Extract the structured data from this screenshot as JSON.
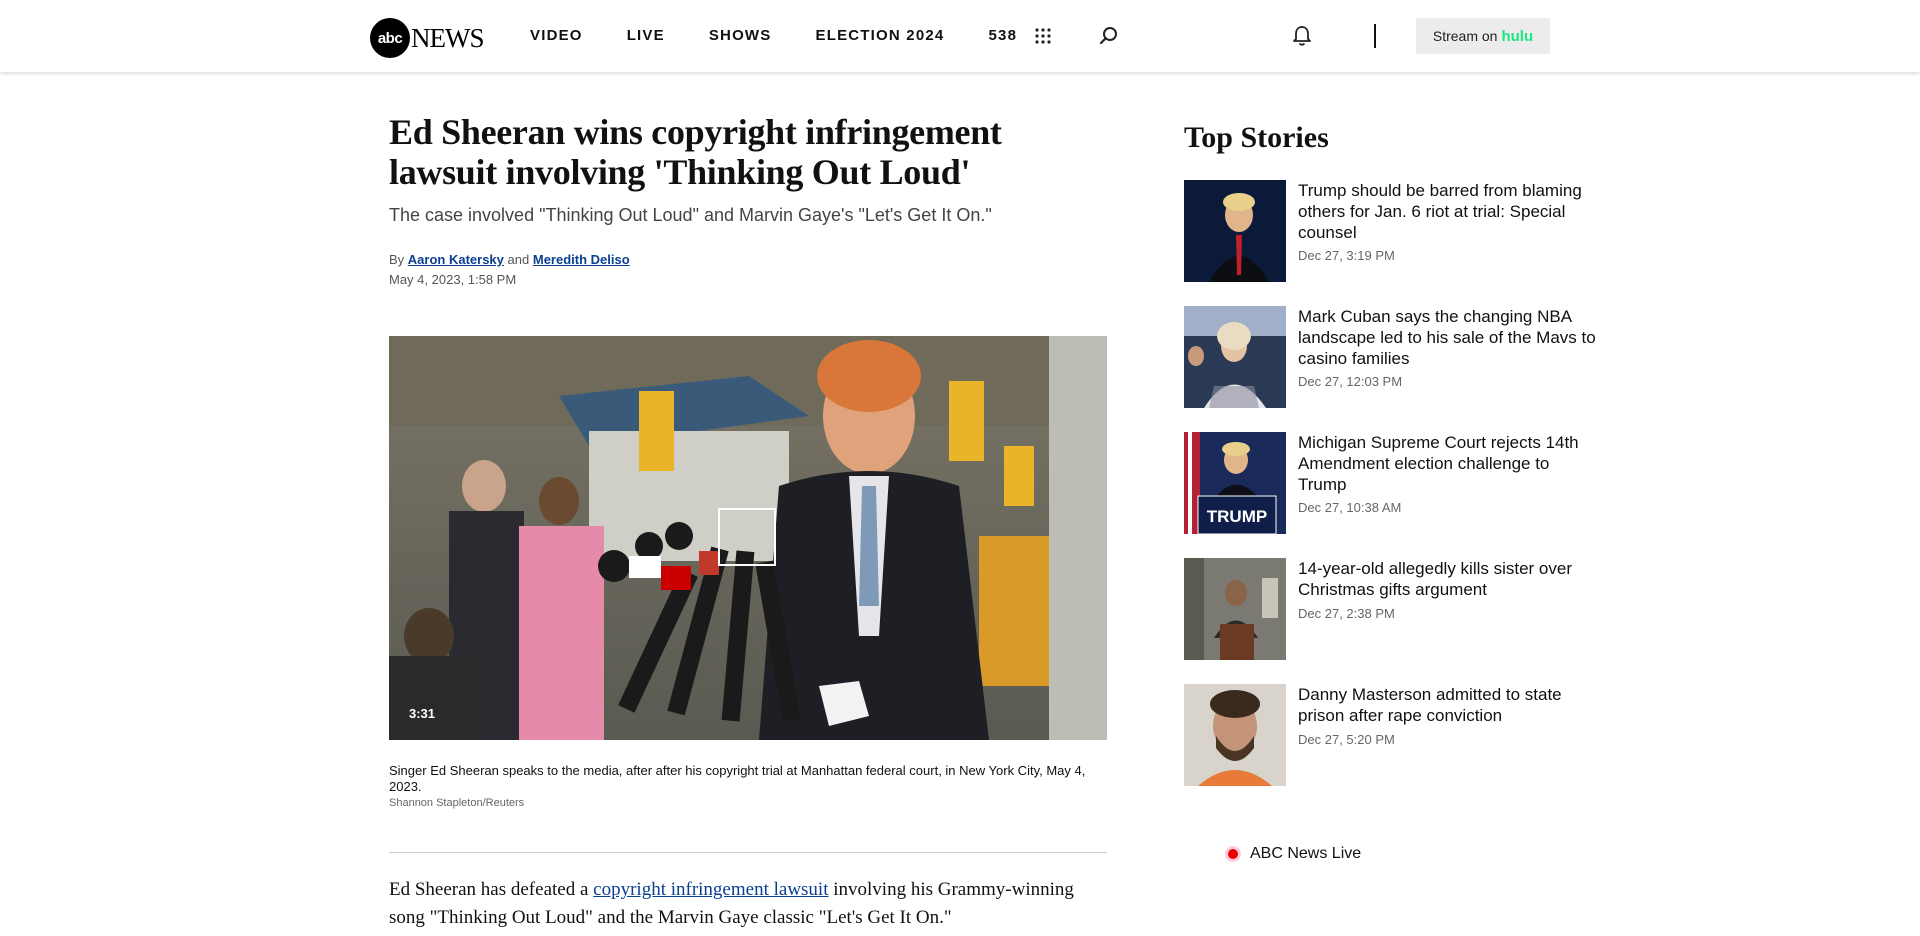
{
  "header": {
    "logo_mark": "abc",
    "logo_text": "NEWS",
    "nav": [
      "VIDEO",
      "LIVE",
      "SHOWS",
      "ELECTION 2024",
      "538"
    ],
    "stream_label": "Stream on",
    "stream_brand": "hulu",
    "icons": [
      "apps-grid-icon",
      "search-icon",
      "bell-icon"
    ]
  },
  "article": {
    "headline": "Ed Sheeran wins copyright infringement lawsuit involving 'Thinking Out Loud'",
    "subhead": "The case involved \"Thinking Out Loud\" and Marvin Gaye's \"Let's Get It On.\"",
    "by": "By",
    "and": "and",
    "author1": "Aaron Katersky",
    "author2": "Meredith Deliso",
    "date": "May 4, 2023, 1:58 PM",
    "video_duration": "3:31",
    "caption": "Singer Ed Sheeran speaks to the media, after after his copyright trial at Manhattan federal court, in New York City, May 4, 2023.",
    "credit": "Shannon Stapleton/Reuters",
    "body_pre": "Ed Sheeran has defeated a ",
    "body_link": "copyright infringement lawsuit",
    "body_post": " involving his Grammy-winning song \"Thinking Out Loud\" and the Marvin Gaye classic \"Let's Get It On.\""
  },
  "sidebar": {
    "title": "Top Stories",
    "stories": [
      {
        "title": "Trump should be barred from blaming others for Jan. 6 riot at trial: Special counsel",
        "date": "Dec 27, 3:19 PM"
      },
      {
        "title": "Mark Cuban says the changing NBA landscape led to his sale of the Mavs to casino families",
        "date": "Dec 27, 12:03 PM"
      },
      {
        "title": "Michigan Supreme Court rejects 14th Amendment election challenge to Trump",
        "date": "Dec 27, 10:38 AM"
      },
      {
        "title": "14-year-old allegedly kills sister over Christmas gifts argument",
        "date": "Dec 27, 2:38 PM"
      },
      {
        "title": "Danny Masterson admitted to state prison after rape conviction",
        "date": "Dec 27, 5:20 PM"
      }
    ],
    "thumb_sign_text": "TRUMP",
    "live_label": "ABC News Live"
  }
}
